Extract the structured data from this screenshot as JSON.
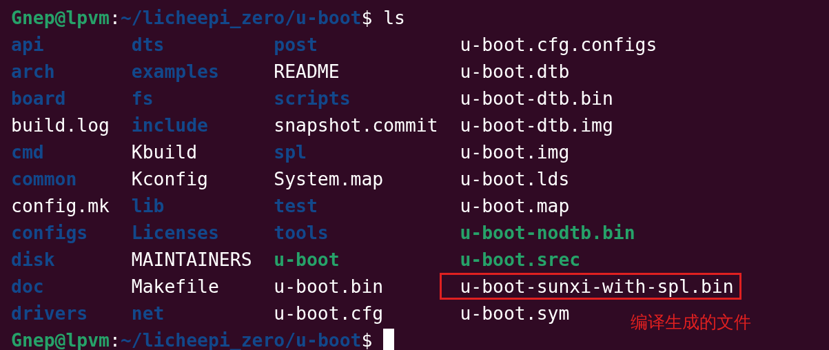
{
  "prompt_top": {
    "user_host": "Gnep@lpvm",
    "separator": ":",
    "path": "~/licheepi_zero/u-boot",
    "symbol": "$",
    "command": "ls"
  },
  "listing": [
    [
      {
        "name": "api",
        "kind": "dir",
        "highlighted": false
      },
      {
        "name": "dts",
        "kind": "dir",
        "highlighted": false
      },
      {
        "name": "post",
        "kind": "dir",
        "highlighted": false
      },
      {
        "name": "u-boot.cfg.configs",
        "kind": "file",
        "highlighted": false
      }
    ],
    [
      {
        "name": "arch",
        "kind": "dir",
        "highlighted": false
      },
      {
        "name": "examples",
        "kind": "dir",
        "highlighted": false
      },
      {
        "name": "README",
        "kind": "file",
        "highlighted": false
      },
      {
        "name": "u-boot.dtb",
        "kind": "file",
        "highlighted": false
      }
    ],
    [
      {
        "name": "board",
        "kind": "dir",
        "highlighted": false
      },
      {
        "name": "fs",
        "kind": "dir",
        "highlighted": false
      },
      {
        "name": "scripts",
        "kind": "dir",
        "highlighted": false
      },
      {
        "name": "u-boot-dtb.bin",
        "kind": "file",
        "highlighted": false
      }
    ],
    [
      {
        "name": "build.log",
        "kind": "file",
        "highlighted": false
      },
      {
        "name": "include",
        "kind": "dir",
        "highlighted": false
      },
      {
        "name": "snapshot.commit",
        "kind": "file",
        "highlighted": false
      },
      {
        "name": "u-boot-dtb.img",
        "kind": "file",
        "highlighted": false
      }
    ],
    [
      {
        "name": "cmd",
        "kind": "dir",
        "highlighted": false
      },
      {
        "name": "Kbuild",
        "kind": "file",
        "highlighted": false
      },
      {
        "name": "spl",
        "kind": "dir",
        "highlighted": false
      },
      {
        "name": "u-boot.img",
        "kind": "file",
        "highlighted": false
      }
    ],
    [
      {
        "name": "common",
        "kind": "dir",
        "highlighted": false
      },
      {
        "name": "Kconfig",
        "kind": "file",
        "highlighted": false
      },
      {
        "name": "System.map",
        "kind": "file",
        "highlighted": false
      },
      {
        "name": "u-boot.lds",
        "kind": "file",
        "highlighted": false
      }
    ],
    [
      {
        "name": "config.mk",
        "kind": "file",
        "highlighted": false
      },
      {
        "name": "lib",
        "kind": "dir",
        "highlighted": false
      },
      {
        "name": "test",
        "kind": "dir",
        "highlighted": false
      },
      {
        "name": "u-boot.map",
        "kind": "file",
        "highlighted": false
      }
    ],
    [
      {
        "name": "configs",
        "kind": "dir",
        "highlighted": false
      },
      {
        "name": "Licenses",
        "kind": "dir",
        "highlighted": false
      },
      {
        "name": "tools",
        "kind": "dir",
        "highlighted": false
      },
      {
        "name": "u-boot-nodtb.bin",
        "kind": "exec",
        "highlighted": false
      }
    ],
    [
      {
        "name": "disk",
        "kind": "dir",
        "highlighted": false
      },
      {
        "name": "MAINTAINERS",
        "kind": "file",
        "highlighted": false
      },
      {
        "name": "u-boot",
        "kind": "exec",
        "highlighted": false
      },
      {
        "name": "u-boot.srec",
        "kind": "exec",
        "highlighted": false
      }
    ],
    [
      {
        "name": "doc",
        "kind": "dir",
        "highlighted": false
      },
      {
        "name": "Makefile",
        "kind": "file",
        "highlighted": false
      },
      {
        "name": "u-boot.bin",
        "kind": "file",
        "highlighted": false
      },
      {
        "name": "u-boot-sunxi-with-spl.bin",
        "kind": "file",
        "highlighted": true
      }
    ],
    [
      {
        "name": "drivers",
        "kind": "dir",
        "highlighted": false
      },
      {
        "name": "net",
        "kind": "dir",
        "highlighted": false
      },
      {
        "name": "u-boot.cfg",
        "kind": "file",
        "highlighted": false
      },
      {
        "name": "u-boot.sym",
        "kind": "file",
        "highlighted": false
      }
    ]
  ],
  "prompt_bottom": {
    "user_host": "Gnep@lpvm",
    "separator": ":",
    "path": "~/licheepi_zero/u-boot",
    "symbol": "$"
  },
  "annotation": {
    "text": "编译生成的文件"
  }
}
